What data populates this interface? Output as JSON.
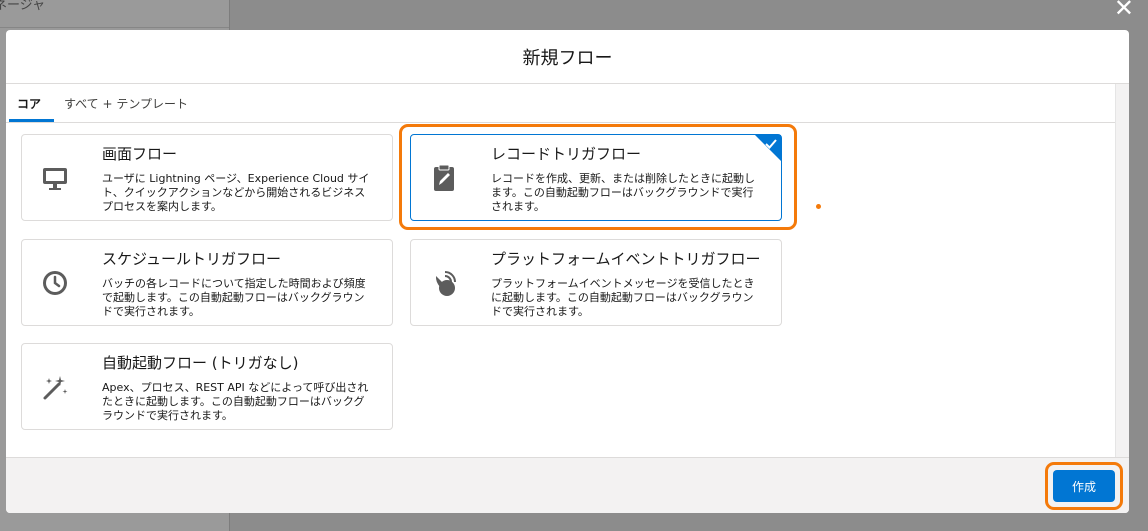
{
  "background": {
    "panel_text": "ネージャ"
  },
  "modal": {
    "title": "新規フロー",
    "tabs": [
      {
        "label": "コア"
      },
      {
        "label": "すべて + テンプレート"
      }
    ],
    "cards": [
      {
        "title": "画面フロー",
        "description": "ユーザに Lightning ページ、Experience Cloud サイト、クイックアクションなどから開始されるビジネスプロセスを案内します。",
        "icon": "monitor-icon"
      },
      {
        "title": "レコードトリガフロー",
        "description": "レコードを作成、更新、または削除したときに起動します。この自動起動フローはバックグラウンドで実行されます。",
        "icon": "clipboard-edit-icon",
        "selected": true
      },
      {
        "title": "スケジュールトリガフロー",
        "description": "バッチの各レコードについて指定した時間および頻度で起動します。この自動起動フローはバックグラウンドで実行されます。",
        "icon": "clock-icon"
      },
      {
        "title": "プラットフォームイベントトリガフロー",
        "description": "プラットフォームイベントメッセージを受信したときに起動します。この自動起動フローはバックグラウンドで実行されます。",
        "icon": "satellite-dish-icon"
      },
      {
        "title": "自動起動フロー (トリガなし)",
        "description": "Apex、プロセス、REST API などによって呼び出されたときに起動します。この自動起動フローはバックグラウンドで実行されます。",
        "icon": "magic-wand-icon"
      }
    ],
    "create_button": "作成"
  },
  "colors": {
    "accent": "#0176d3",
    "highlight": "#f47a0a"
  }
}
